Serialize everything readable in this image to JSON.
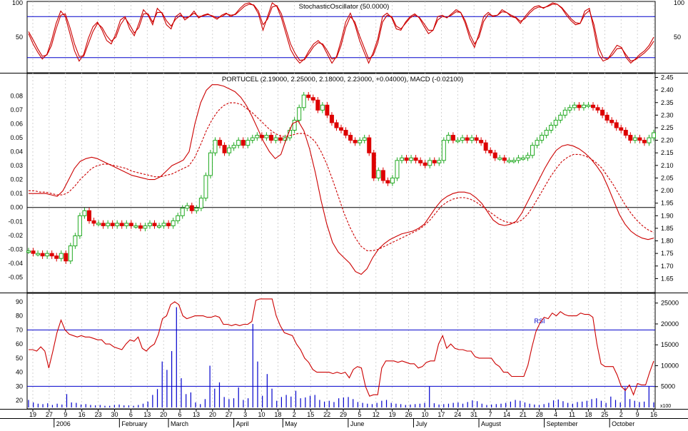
{
  "colors": {
    "background": "#ffffff",
    "frame": "#000000",
    "grid": "#c0c0c0",
    "oscillator": "#cc0000",
    "level_line": "#0000cc",
    "up_candle": "#22aa22",
    "down_candle": "#dd0000",
    "volume": "#0000cc"
  },
  "chart_data": [
    {
      "type": "line",
      "title": "StochasticOscillator (50.0000)",
      "ylim": [
        0,
        100
      ],
      "yticks_right": [
        "100",
        "50"
      ],
      "yticks_left": [
        "100",
        "50"
      ],
      "levels": [
        80,
        20
      ],
      "grid": "vertical dotted",
      "series": [
        {
          "values": [
            55,
            40,
            28,
            18,
            25,
            45,
            70,
            88,
            80,
            55,
            30,
            15,
            25,
            48,
            65,
            72,
            60,
            45,
            40,
            55,
            75,
            80,
            62,
            52,
            70,
            90,
            82,
            68,
            92,
            85,
            68,
            62,
            80,
            85,
            75,
            80,
            88,
            78,
            82,
            84,
            80,
            76,
            82,
            85,
            80,
            84,
            92,
            98,
            100,
            96,
            84,
            60,
            80,
            100,
            95,
            78,
            55,
            32,
            20,
            12,
            18,
            30,
            40,
            45,
            38,
            25,
            12,
            22,
            45,
            72,
            85,
            68,
            45,
            28,
            12,
            28,
            48,
            80,
            85,
            78,
            62,
            60,
            72,
            80,
            84,
            78,
            66,
            55,
            60,
            80,
            82,
            78,
            84,
            90,
            86,
            70,
            48,
            35,
            55,
            80,
            86,
            80,
            82,
            90,
            86,
            80,
            78,
            70,
            80,
            88,
            94,
            96,
            92,
            96,
            100,
            98,
            92,
            82,
            74,
            68,
            70,
            88,
            92,
            60,
            25,
            15,
            18,
            28,
            38,
            35,
            20,
            12,
            18,
            25,
            30,
            38,
            50
          ]
        },
        {
          "values": [
            58,
            46,
            33,
            22,
            24,
            38,
            62,
            82,
            84,
            64,
            40,
            22,
            22,
            40,
            58,
            70,
            64,
            52,
            44,
            50,
            68,
            78,
            68,
            56,
            64,
            84,
            84,
            72,
            86,
            86,
            74,
            66,
            76,
            82,
            78,
            80,
            85,
            80,
            81,
            83,
            81,
            78,
            80,
            84,
            82,
            83,
            89,
            95,
            98,
            97,
            88,
            68,
            76,
            94,
            96,
            84,
            62,
            40,
            26,
            16,
            17,
            26,
            36,
            42,
            40,
            30,
            18,
            20,
            38,
            64,
            80,
            72,
            52,
            35,
            18,
            24,
            42,
            72,
            82,
            80,
            66,
            62,
            70,
            78,
            82,
            79,
            70,
            60,
            60,
            75,
            80,
            79,
            82,
            87,
            86,
            74,
            54,
            40,
            50,
            73,
            83,
            81,
            82,
            87,
            86,
            82,
            79,
            73,
            77,
            85,
            91,
            94,
            93,
            95,
            98,
            98,
            93,
            85,
            77,
            71,
            70,
            83,
            89,
            68,
            35,
            20,
            18,
            24,
            33,
            34,
            24,
            15,
            17,
            22,
            27,
            34,
            44
          ]
        }
      ]
    },
    {
      "type": "candlestick",
      "title": "PORTUCEL (2.19000, 2.25000, 2.18000, 2.23000, +0.04000), MACD (-0.02100)",
      "ylim_left": [
        -0.06,
        0.095
      ],
      "yticks_left": [
        "0.08",
        "0.07",
        "0.06",
        "0.05",
        "0.04",
        "0.03",
        "0.02",
        "0.01",
        "0.00",
        "-0.01",
        "-0.02",
        "-0.03",
        "-0.04",
        "-0.05"
      ],
      "ylim_right": [
        1.6,
        2.46
      ],
      "yticks_right": [
        "2.45",
        "2.40",
        "2.35",
        "2.30",
        "2.25",
        "2.20",
        "2.15",
        "2.10",
        "2.05",
        "2.00",
        "1.95",
        "1.90",
        "1.85",
        "1.80",
        "1.75",
        "1.70",
        "1.65"
      ],
      "zero_line": 0,
      "grid": "vertical dotted",
      "price_close": [
        1.76,
        1.75,
        1.75,
        1.74,
        1.75,
        1.74,
        1.73,
        1.75,
        1.72,
        1.78,
        1.82,
        1.9,
        1.92,
        1.88,
        1.87,
        1.87,
        1.86,
        1.87,
        1.86,
        1.87,
        1.86,
        1.87,
        1.86,
        1.86,
        1.85,
        1.86,
        1.87,
        1.86,
        1.86,
        1.87,
        1.86,
        1.88,
        1.9,
        1.93,
        1.94,
        1.92,
        1.93,
        1.97,
        2.06,
        2.15,
        2.2,
        2.18,
        2.15,
        2.17,
        2.18,
        2.2,
        2.18,
        2.2,
        2.21,
        2.22,
        2.21,
        2.22,
        2.2,
        2.21,
        2.2,
        2.21,
        2.24,
        2.28,
        2.33,
        2.38,
        2.37,
        2.36,
        2.32,
        2.34,
        2.3,
        2.27,
        2.25,
        2.24,
        2.22,
        2.2,
        2.19,
        2.2,
        2.21,
        2.15,
        2.05,
        2.08,
        2.04,
        2.03,
        2.05,
        2.12,
        2.13,
        2.12,
        2.13,
        2.12,
        2.11,
        2.1,
        2.12,
        2.11,
        2.12,
        2.2,
        2.22,
        2.2,
        2.2,
        2.21,
        2.2,
        2.21,
        2.2,
        2.19,
        2.16,
        2.15,
        2.13,
        2.13,
        2.12,
        2.12,
        2.12,
        2.13,
        2.13,
        2.14,
        2.18,
        2.2,
        2.22,
        2.24,
        2.26,
        2.28,
        2.3,
        2.32,
        2.33,
        2.34,
        2.33,
        2.34,
        2.34,
        2.33,
        2.32,
        2.3,
        2.28,
        2.27,
        2.25,
        2.24,
        2.22,
        2.2,
        2.21,
        2.2,
        2.19,
        2.21,
        2.23
      ],
      "series": [
        {
          "name": "MACD",
          "values": [
            0.01,
            0.01,
            0.01,
            0.01,
            0.009,
            0.008,
            0.012,
            0.02,
            0.028,
            0.033,
            0.035,
            0.036,
            0.035,
            0.033,
            0.031,
            0.029,
            0.027,
            0.025,
            0.023,
            0.022,
            0.021,
            0.02,
            0.02,
            0.022,
            0.026,
            0.03,
            0.032,
            0.034,
            0.04,
            0.06,
            0.075,
            0.084,
            0.088,
            0.088,
            0.087,
            0.085,
            0.083,
            0.079,
            0.073,
            0.065,
            0.056,
            0.047,
            0.04,
            0.035,
            0.038,
            0.05,
            0.06,
            0.062,
            0.055,
            0.042,
            0.025,
            0.005,
            -0.012,
            -0.025,
            -0.032,
            -0.036,
            -0.04,
            -0.046,
            -0.048,
            -0.044,
            -0.036,
            -0.03,
            -0.026,
            -0.023,
            -0.021,
            -0.019,
            -0.018,
            -0.017,
            -0.015,
            -0.012,
            -0.006,
            0.0,
            0.005,
            0.008,
            0.01,
            0.011,
            0.011,
            0.01,
            0.007,
            0.003,
            -0.003,
            -0.009,
            -0.012,
            -0.013,
            -0.012,
            -0.01,
            -0.004,
            0.004,
            0.012,
            0.02,
            0.028,
            0.035,
            0.041,
            0.044,
            0.045,
            0.044,
            0.042,
            0.039,
            0.035,
            0.03,
            0.024,
            0.015,
            0.005,
            -0.005,
            -0.012,
            -0.017,
            -0.02,
            -0.022,
            -0.023,
            -0.022
          ]
        },
        {
          "name": "Signal",
          "values": [
            0.012,
            0.012,
            0.011,
            0.011,
            0.01,
            0.009,
            0.009,
            0.011,
            0.015,
            0.02,
            0.024,
            0.028,
            0.03,
            0.031,
            0.031,
            0.03,
            0.029,
            0.028,
            0.026,
            0.025,
            0.024,
            0.023,
            0.022,
            0.022,
            0.023,
            0.024,
            0.026,
            0.028,
            0.03,
            0.036,
            0.045,
            0.055,
            0.063,
            0.069,
            0.073,
            0.075,
            0.075,
            0.074,
            0.071,
            0.068,
            0.064,
            0.06,
            0.056,
            0.053,
            0.051,
            0.051,
            0.052,
            0.053,
            0.053,
            0.051,
            0.047,
            0.04,
            0.031,
            0.02,
            0.008,
            -0.004,
            -0.014,
            -0.022,
            -0.028,
            -0.031,
            -0.031,
            -0.03,
            -0.028,
            -0.026,
            -0.024,
            -0.022,
            -0.02,
            -0.018,
            -0.016,
            -0.013,
            -0.009,
            -0.004,
            0.001,
            0.004,
            0.006,
            0.007,
            0.007,
            0.006,
            0.004,
            0.001,
            -0.002,
            -0.005,
            -0.008,
            -0.01,
            -0.011,
            -0.011,
            -0.009,
            -0.005,
            0.001,
            0.008,
            0.015,
            0.022,
            0.028,
            0.033,
            0.036,
            0.038,
            0.038,
            0.037,
            0.035,
            0.032,
            0.028,
            0.022,
            0.016,
            0.009,
            0.002,
            -0.004,
            -0.009,
            -0.013,
            -0.016,
            -0.018
          ]
        }
      ]
    },
    {
      "type": "line",
      "title": "RSI",
      "ylim": [
        15,
        95
      ],
      "yticks_left": [
        "90",
        "80",
        "70",
        "60",
        "50",
        "40",
        "30",
        "20"
      ],
      "levels": [
        70,
        30
      ],
      "volume_axis": {
        "ylim": [
          0,
          27000
        ],
        "yticks_right": [
          "25000",
          "20000",
          "15000",
          "10000",
          "5000"
        ],
        "unit": "x100"
      },
      "grid": "vertical dotted",
      "series": [
        {
          "name": "RSI",
          "values": [
            56,
            56,
            55,
            58,
            55,
            43,
            55,
            68,
            77,
            70,
            67,
            66,
            65,
            66,
            65,
            65,
            64,
            63,
            63,
            60,
            60,
            58,
            57,
            56,
            60,
            63,
            62,
            65,
            57,
            55,
            58,
            60,
            67,
            78,
            80,
            88,
            90,
            88,
            80,
            78,
            79,
            80,
            80,
            80,
            79,
            79,
            80,
            79,
            74,
            74,
            73,
            74,
            73,
            74,
            74,
            76,
            91,
            92,
            92,
            92,
            92,
            80,
            73,
            68,
            67,
            66,
            60,
            56,
            50,
            47,
            42,
            40,
            40,
            40,
            40,
            39,
            40,
            39,
            40,
            36,
            42,
            44,
            43,
            30,
            23,
            24,
            24,
            43,
            48,
            48,
            48,
            47,
            48,
            47,
            46,
            46,
            43,
            44,
            47,
            48,
            48,
            60,
            66,
            57,
            60,
            57,
            56,
            56,
            55,
            55,
            51,
            50,
            50,
            50,
            50,
            46,
            44,
            40,
            40,
            37,
            37,
            37,
            37,
            45,
            58,
            69,
            75,
            79,
            78,
            82,
            80,
            83,
            81,
            80,
            80,
            80,
            82,
            81,
            81,
            79,
            60,
            46,
            44,
            44,
            44,
            38,
            30,
            27,
            31,
            24,
            32,
            31,
            31,
            40,
            48
          ]
        },
        {
          "name": "Volume",
          "values": [
            1800,
            1200,
            900,
            800,
            1000,
            600,
            900,
            700,
            3200,
            1200,
            1100,
            700,
            800,
            600,
            500,
            600,
            400,
            400,
            600,
            700,
            500,
            500,
            400,
            600,
            900,
            1400,
            3000,
            4400,
            11000,
            9000,
            13500,
            24000,
            7000,
            3200,
            3600,
            1200,
            800,
            2000,
            10000,
            4500,
            6000,
            2500,
            2000,
            2200,
            4800,
            1800,
            2200,
            20000,
            11000,
            2800,
            8000,
            4500,
            1600,
            2500,
            3000,
            2600,
            4000,
            2200,
            2400,
            2800,
            3000,
            1800,
            1400,
            1600,
            1300,
            2200,
            2400,
            2500,
            2000,
            1300,
            1100,
            900,
            800,
            1100,
            1600,
            1800,
            1100,
            900,
            800,
            600,
            700,
            800,
            900,
            1100,
            5000,
            1000,
            700,
            800,
            900,
            1100,
            1200,
            900,
            1300,
            1700,
            1500,
            900,
            600,
            700,
            800,
            900,
            1100,
            1400,
            1800,
            1600,
            1200,
            900,
            700,
            600,
            800,
            1100,
            1700,
            1900,
            1500,
            1100,
            900,
            1300,
            1400,
            1600,
            2000,
            2200,
            1600,
            1100,
            2600,
            1800,
            1200,
            4800,
            2000,
            1600,
            1300,
            1400,
            5000,
            1200
          ]
        }
      ]
    }
  ],
  "x_axis": {
    "day_ticks": [
      "19",
      "27",
      "9",
      "16",
      "23",
      "30",
      "6",
      "13",
      "20",
      "6",
      "13",
      "20",
      "27",
      "3",
      "10",
      "18",
      "2",
      "15",
      "22",
      "29",
      "5",
      "12",
      "19",
      "26",
      "10",
      "17",
      "24",
      "31",
      "7",
      "14",
      "21",
      "28",
      "4",
      "11",
      "18",
      "25",
      "2",
      "9",
      "16"
    ],
    "month_labels": [
      "2006",
      "February",
      "March",
      "April",
      "May",
      "June",
      "July",
      "August",
      "September",
      "October"
    ]
  }
}
